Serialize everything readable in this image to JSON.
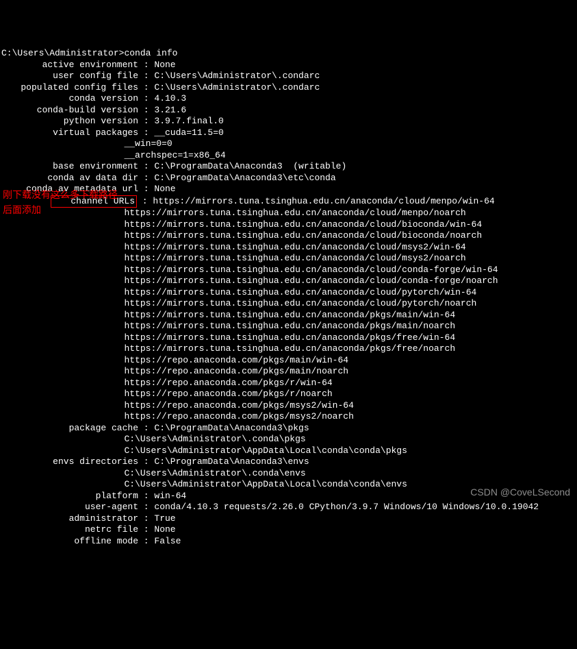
{
  "prompt": "C:\\Users\\Administrator>",
  "command": "conda info",
  "sep": " : ",
  "indent_bare": "                       ",
  "annotation_line1": "刚下载没有这么多下载路径",
  "annotation_line2": "后面添加",
  "watermark": "CSDN @CoveLSecond",
  "rows": [
    {
      "label": "active environment",
      "values": [
        "None"
      ]
    },
    {
      "label": "user config file",
      "values": [
        "C:\\Users\\Administrator\\.condarc"
      ]
    },
    {
      "label": "populated config files",
      "values": [
        "C:\\Users\\Administrator\\.condarc"
      ]
    },
    {
      "label": "conda version",
      "values": [
        "4.10.3"
      ]
    },
    {
      "label": "conda-build version",
      "values": [
        "3.21.6"
      ]
    },
    {
      "label": "python version",
      "values": [
        "3.9.7.final.0"
      ]
    },
    {
      "label": "virtual packages",
      "values": [
        "__cuda=11.5=0",
        "__win=0=0",
        "__archspec=1=x86_64"
      ]
    },
    {
      "label": "base environment",
      "values": [
        "C:\\ProgramData\\Anaconda3  (writable)"
      ]
    },
    {
      "label": "conda av data dir",
      "values": [
        "C:\\ProgramData\\Anaconda3\\etc\\conda"
      ]
    },
    {
      "label": "conda av metadata url",
      "values": [
        "None"
      ]
    },
    {
      "label": "channel URLs",
      "highlight": true,
      "values": [
        "https://mirrors.tuna.tsinghua.edu.cn/anaconda/cloud/menpo/win-64",
        "https://mirrors.tuna.tsinghua.edu.cn/anaconda/cloud/menpo/noarch",
        "https://mirrors.tuna.tsinghua.edu.cn/anaconda/cloud/bioconda/win-64",
        "https://mirrors.tuna.tsinghua.edu.cn/anaconda/cloud/bioconda/noarch",
        "https://mirrors.tuna.tsinghua.edu.cn/anaconda/cloud/msys2/win-64",
        "https://mirrors.tuna.tsinghua.edu.cn/anaconda/cloud/msys2/noarch",
        "https://mirrors.tuna.tsinghua.edu.cn/anaconda/cloud/conda-forge/win-64",
        "https://mirrors.tuna.tsinghua.edu.cn/anaconda/cloud/conda-forge/noarch",
        "https://mirrors.tuna.tsinghua.edu.cn/anaconda/cloud/pytorch/win-64",
        "https://mirrors.tuna.tsinghua.edu.cn/anaconda/cloud/pytorch/noarch",
        "https://mirrors.tuna.tsinghua.edu.cn/anaconda/pkgs/main/win-64",
        "https://mirrors.tuna.tsinghua.edu.cn/anaconda/pkgs/main/noarch",
        "https://mirrors.tuna.tsinghua.edu.cn/anaconda/pkgs/free/win-64",
        "https://mirrors.tuna.tsinghua.edu.cn/anaconda/pkgs/free/noarch",
        "https://repo.anaconda.com/pkgs/main/win-64",
        "https://repo.anaconda.com/pkgs/main/noarch",
        "https://repo.anaconda.com/pkgs/r/win-64",
        "https://repo.anaconda.com/pkgs/r/noarch",
        "https://repo.anaconda.com/pkgs/msys2/win-64",
        "https://repo.anaconda.com/pkgs/msys2/noarch"
      ]
    },
    {
      "label": "package cache",
      "values": [
        "C:\\ProgramData\\Anaconda3\\pkgs",
        "C:\\Users\\Administrator\\.conda\\pkgs",
        "C:\\Users\\Administrator\\AppData\\Local\\conda\\conda\\pkgs"
      ]
    },
    {
      "label": "envs directories",
      "values": [
        "C:\\ProgramData\\Anaconda3\\envs",
        "C:\\Users\\Administrator\\.conda\\envs",
        "C:\\Users\\Administrator\\AppData\\Local\\conda\\conda\\envs"
      ]
    },
    {
      "label": "platform",
      "values": [
        "win-64"
      ]
    },
    {
      "label": "user-agent",
      "values": [
        "conda/4.10.3 requests/2.26.0 CPython/3.9.7 Windows/10 Windows/10.0.19042"
      ]
    },
    {
      "label": "administrator",
      "values": [
        "True"
      ]
    },
    {
      "label": "netrc file",
      "values": [
        "None"
      ]
    },
    {
      "label": "offline mode",
      "values": [
        "False"
      ]
    }
  ]
}
